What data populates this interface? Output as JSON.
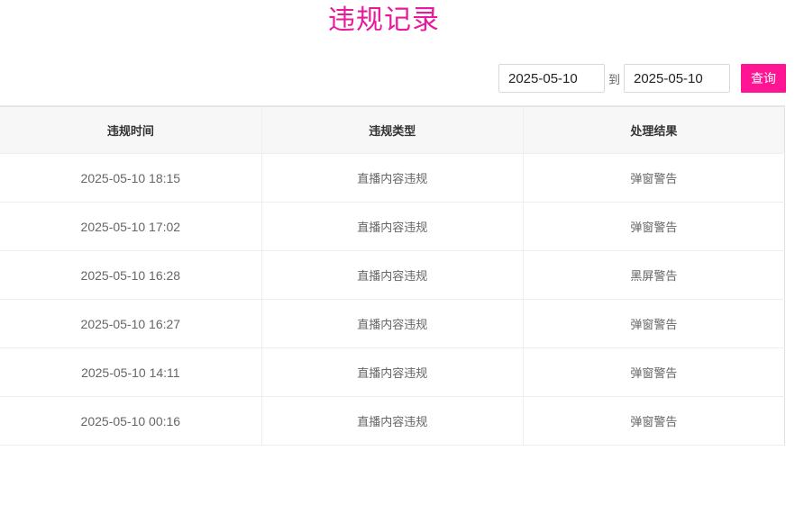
{
  "page": {
    "title": "违规记录"
  },
  "filter": {
    "start_date": "2025-05-10",
    "separator": "到",
    "end_date": "2025-05-10",
    "query_label": "查询"
  },
  "table": {
    "headers": [
      "违规时间",
      "违规类型",
      "处理结果"
    ],
    "rows": [
      {
        "time": "2025-05-10 18:15",
        "type": "直播内容违规",
        "result": "弹窗警告"
      },
      {
        "time": "2025-05-10 17:02",
        "type": "直播内容违规",
        "result": "弹窗警告"
      },
      {
        "time": "2025-05-10 16:28",
        "type": "直播内容违规",
        "result": "黑屏警告"
      },
      {
        "time": "2025-05-10 16:27",
        "type": "直播内容违规",
        "result": "弹窗警告"
      },
      {
        "time": "2025-05-10 14:11",
        "type": "直播内容违规",
        "result": "弹窗警告"
      },
      {
        "time": "2025-05-10 00:16",
        "type": "直播内容违规",
        "result": "弹窗警告"
      }
    ]
  },
  "colors": {
    "accent": "#e8199b",
    "button": "#ff1493",
    "header_bg": "#f7f7f7"
  }
}
